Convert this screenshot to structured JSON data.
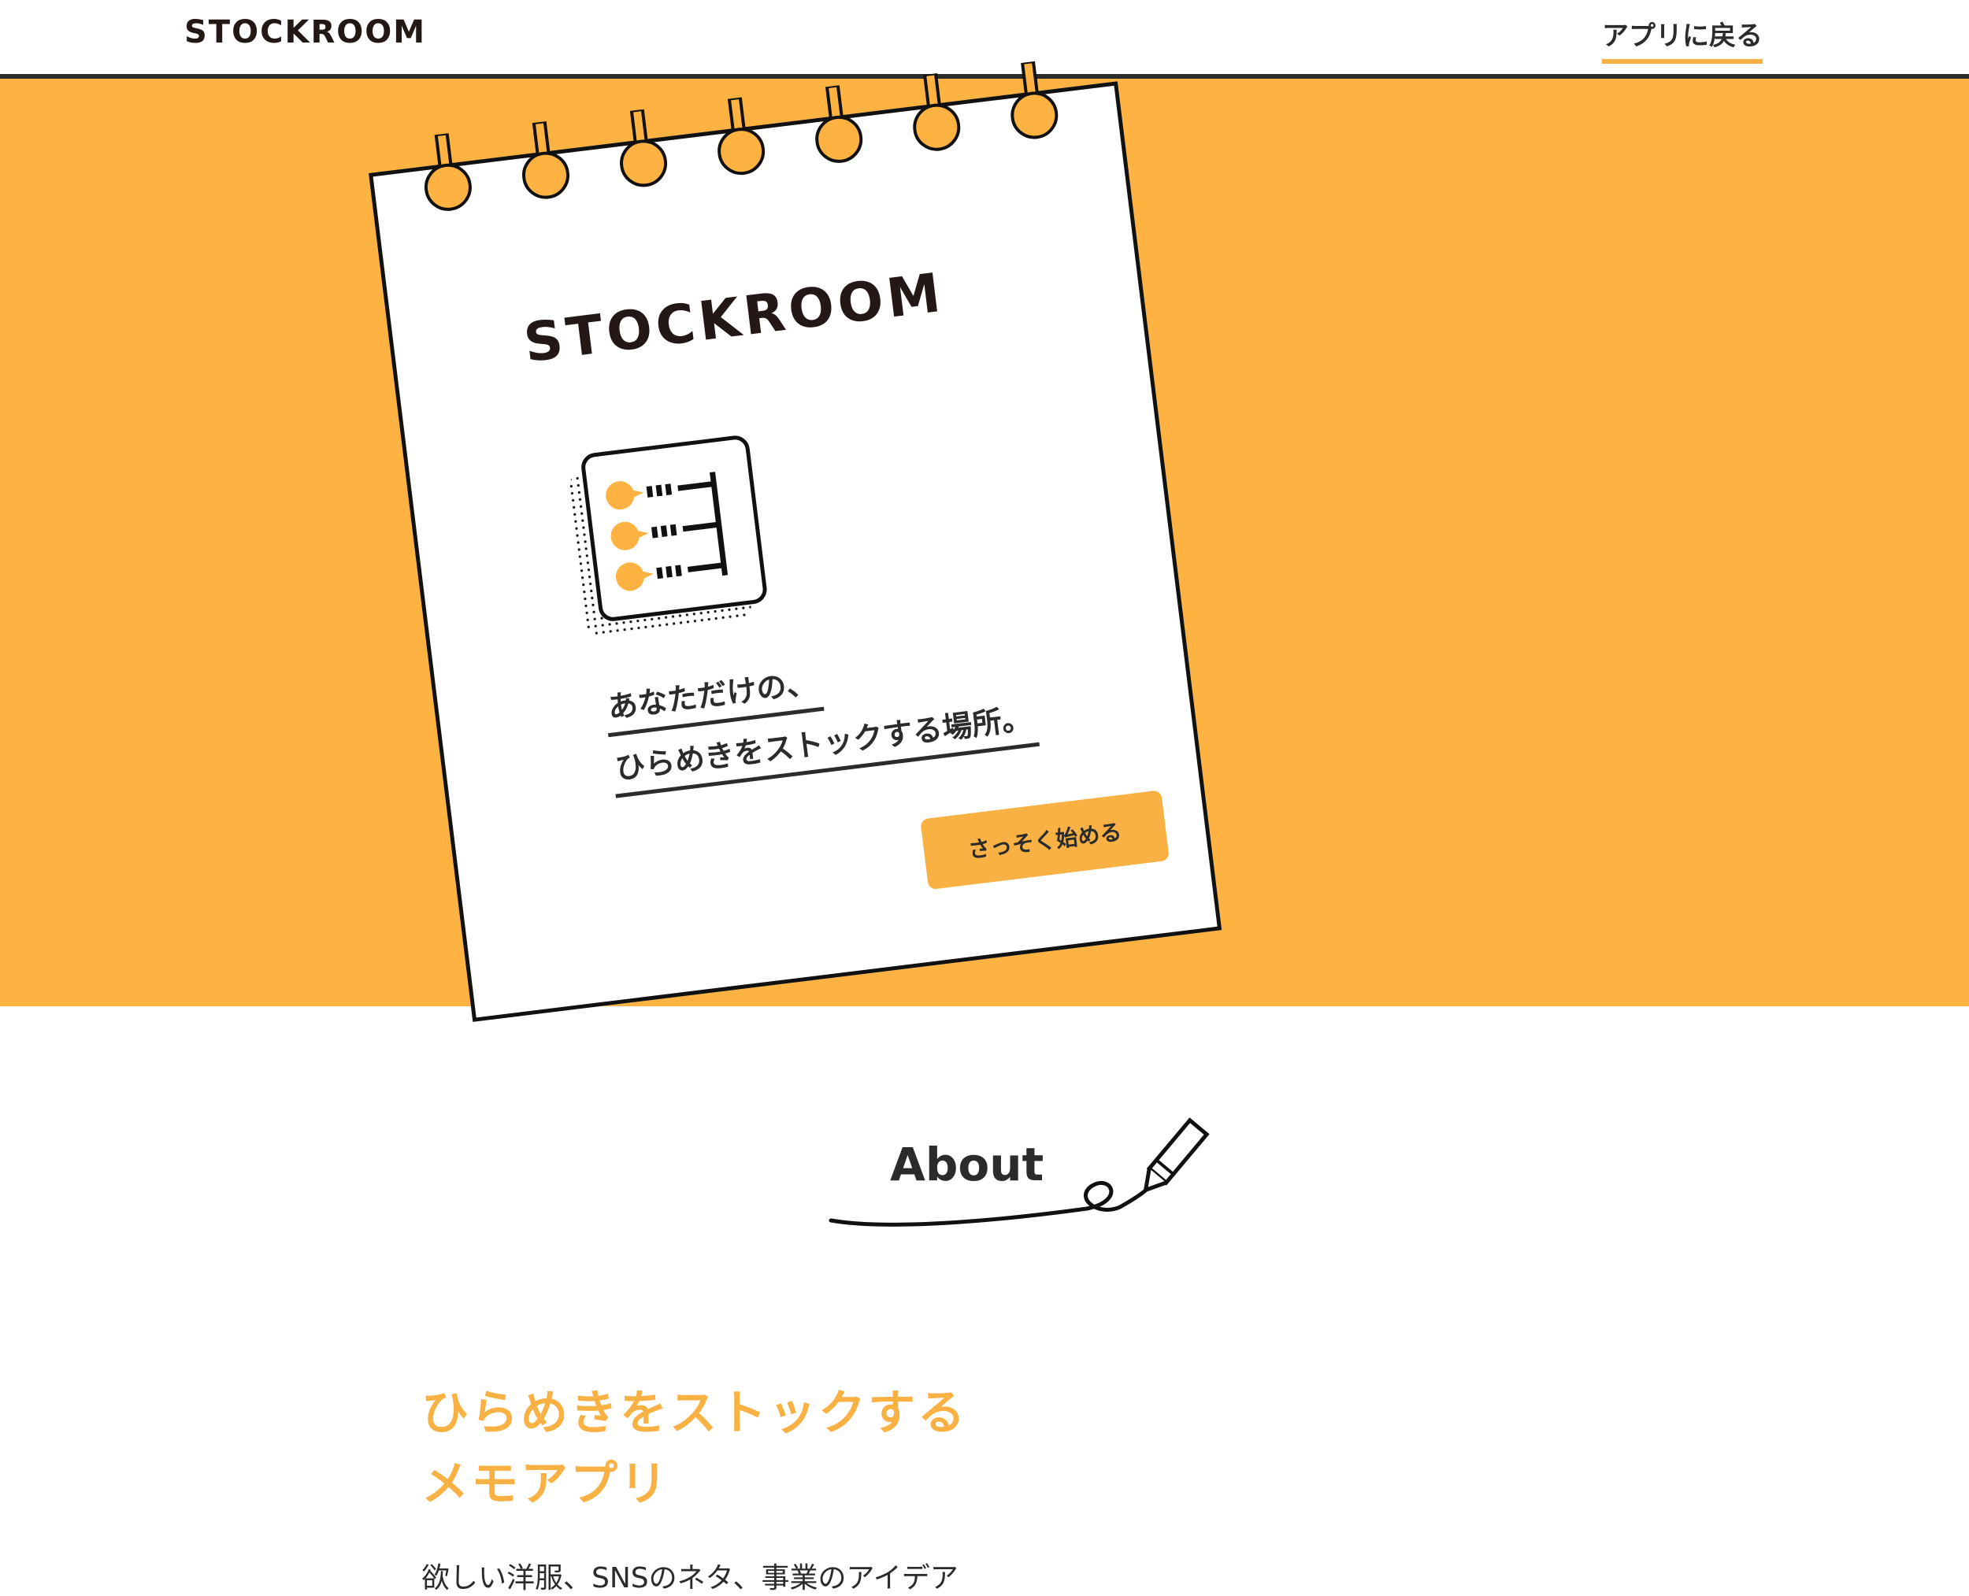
{
  "header": {
    "logo": "STOCKROOM",
    "back_link": "アプリに戻る"
  },
  "hero": {
    "notepad_title": "STOCKROOM",
    "tagline_line1": "あなただけの、",
    "tagline_line2": "ひらめきをストックする場所。",
    "start_button": "さっそく始める",
    "app_icon": "idea-list-icon"
  },
  "about": {
    "heading": "About",
    "decoration": "pencil-icon",
    "subheading_line1": "ひらめきをストックする",
    "subheading_line2": "メモアプリ",
    "body_text": "欲しい洋服、SNSのネタ、事業のアイデア"
  },
  "colors": {
    "accent": "#fdb241",
    "text": "#2b2b2b",
    "ink": "#111111"
  }
}
